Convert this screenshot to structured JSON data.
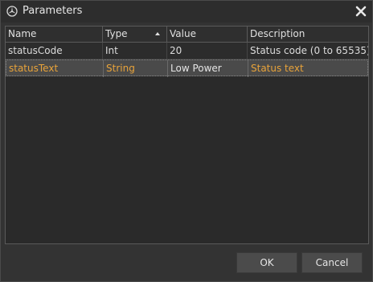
{
  "window": {
    "title": "Parameters",
    "app_icon": "mercedes-star-icon",
    "close_icon": "close-icon"
  },
  "table": {
    "columns": [
      "Name",
      "Type",
      "Value",
      "Description"
    ],
    "sorted_column": "Type",
    "sort_direction": "ascending",
    "rows": [
      {
        "name": "statusCode",
        "type": "Int",
        "value": "20",
        "description": "Status code (0 to 65535)"
      },
      {
        "name": "statusText",
        "type": "String",
        "value": "Low Power",
        "description": "Status text"
      }
    ],
    "selected_row": 1,
    "highlight_color": "#e8a33a"
  },
  "buttons": {
    "ok_label": "OK",
    "cancel_label": "Cancel"
  }
}
